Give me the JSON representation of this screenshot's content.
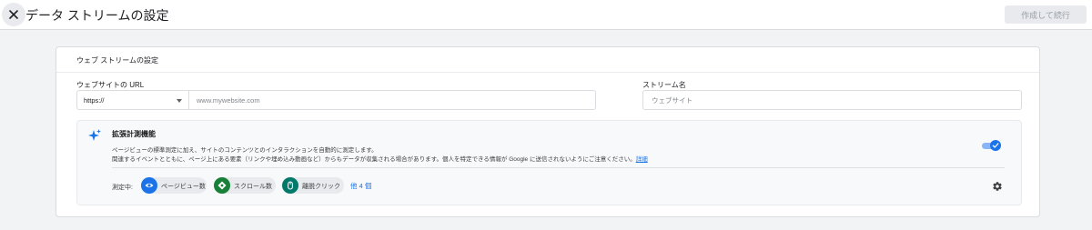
{
  "header": {
    "title": "データ ストリームの設定",
    "primary_button": "作成して続行",
    "close_icon": "close-icon"
  },
  "panel": {
    "title": "ウェブ ストリームの設定",
    "url_field": {
      "label": "ウェブサイトの URL",
      "protocol": "https://",
      "placeholder": "www.mywebsite.com"
    },
    "name_field": {
      "label": "ストリーム名",
      "placeholder": "ウェブサイト"
    },
    "enhanced": {
      "icon": "sparkle-icon",
      "title": "拡張計測機能",
      "desc_line1": "ページビューの標準測定に加え、サイトのコンテンツとのインタラクションを自動的に測定します。",
      "desc_line2": "関連するイベントとともに、ページ上にある要素（リンクや埋め込み動画など）からもデータが収集される場合があります。個人を特定できる情報が Google に送信されないようにご注意ください。",
      "link": "詳細",
      "toggle_on": true,
      "measuring_label": "測定中:",
      "chips": [
        {
          "label": "ページビュー数",
          "icon": "eye-icon",
          "color": "#1a73e8"
        },
        {
          "label": "スクロール数",
          "icon": "crosshair-icon",
          "color": "#188038"
        },
        {
          "label": "離脱クリック",
          "icon": "mouse-icon",
          "color": "#00796b"
        }
      ],
      "more": "他 4 個",
      "settings_icon": "gear-icon"
    }
  }
}
